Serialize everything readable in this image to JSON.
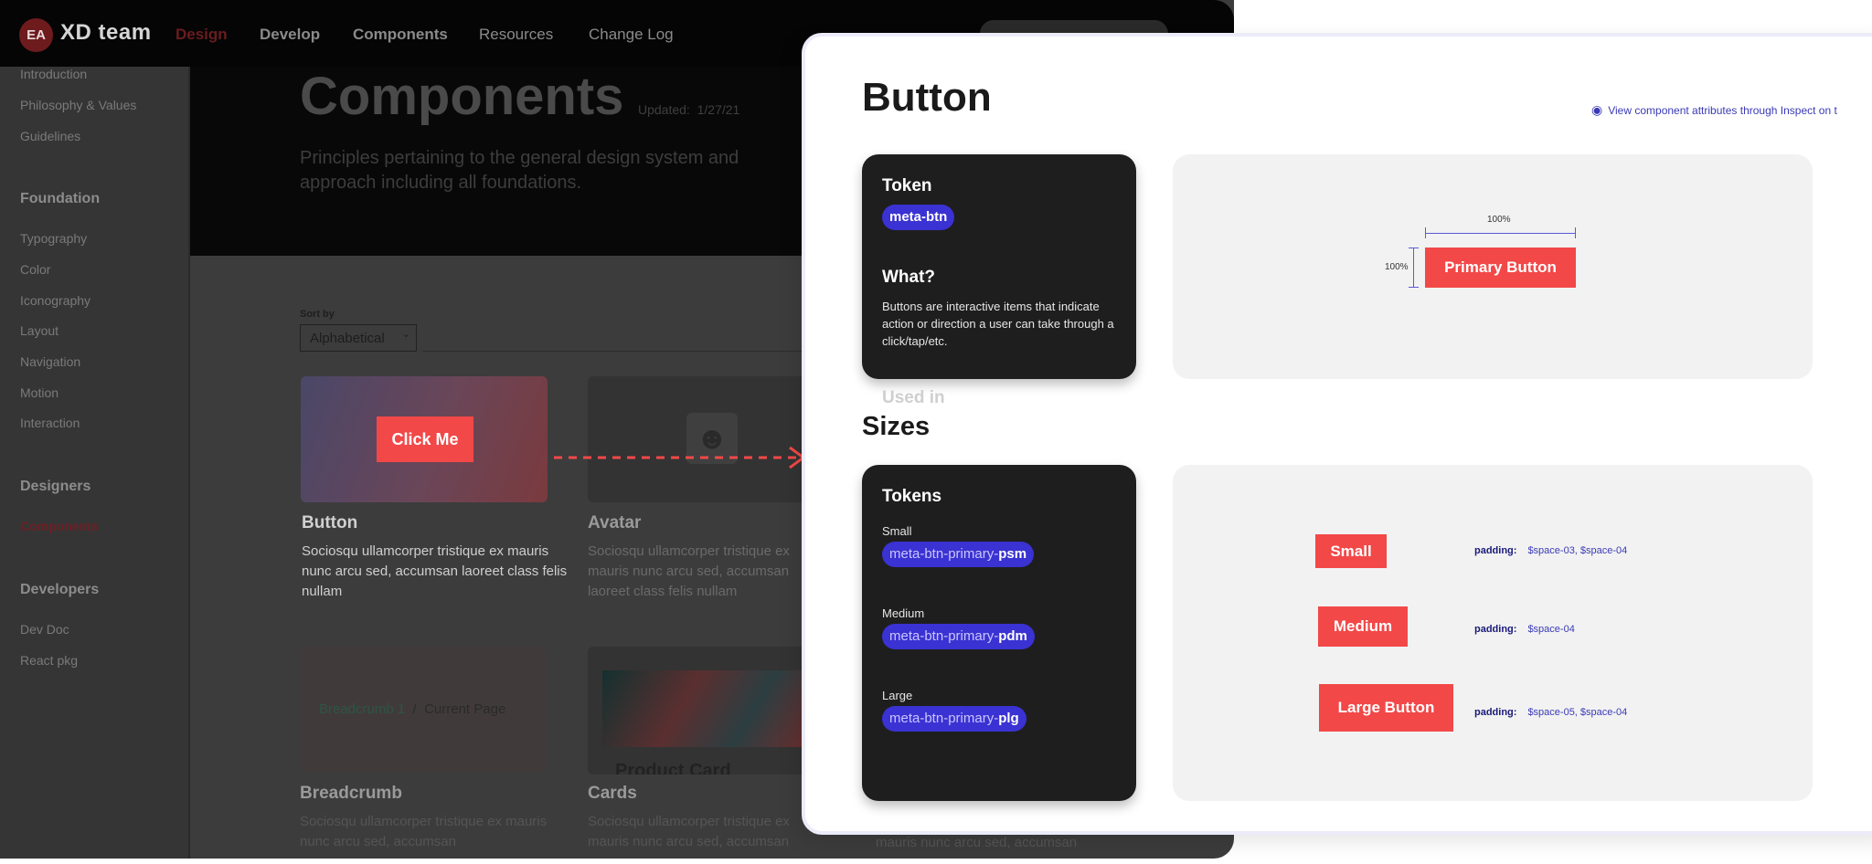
{
  "background": {
    "logo": {
      "badge": "EA",
      "name": "XD team"
    },
    "nav": [
      "Design",
      "Develop",
      "Components",
      "Resources",
      "Change Log"
    ],
    "sidebar": {
      "intro": [
        "Introduction",
        "Philosophy & Values",
        "Guidelines"
      ],
      "foundation_head": "Foundation",
      "foundation": [
        "Typography",
        "Color",
        "Iconography",
        "Layout",
        "Navigation",
        "Motion",
        "Interaction"
      ],
      "designers_head": "Designers",
      "designers": [
        "Components"
      ],
      "developers_head": "Developers",
      "developers": [
        "Dev Doc",
        "React pkg"
      ]
    },
    "hero": {
      "title": "Components",
      "updated_label": "Updated:",
      "updated_value": "1/27/21",
      "description": "Principles pertaining to the general design system and approach including all foundations."
    },
    "sort": {
      "label": "Sort by",
      "value": "Alphabetical"
    },
    "cards": {
      "button": {
        "preview_label": "Click Me",
        "title": "Button",
        "desc": "Sociosqu ullamcorper tristique ex mauris nunc arcu sed, accumsan laoreet class felis nullam"
      },
      "avatar": {
        "title": "Avatar",
        "desc": "Sociosqu ullamcorper tristique ex mauris nunc arcu sed, accumsan laoreet class felis nullam"
      },
      "breadcrumb": {
        "link": "Breadcrumb 1",
        "sep": "/",
        "current": "Current Page",
        "title": "Breadcrumb",
        "desc": "Sociosqu ullamcorper tristique ex mauris nunc arcu sed, accumsan"
      },
      "cards": {
        "preview_label": "Product Card",
        "title": "Cards",
        "desc": "Sociosqu ullamcorper tristique ex mauris nunc arcu sed, accumsan"
      },
      "third_desc": "mauris nunc arcu sed, accumsan"
    }
  },
  "panel": {
    "title": "Button",
    "inspect_link": "View component attributes through Inspect on t",
    "token_card": {
      "token_head": "Token",
      "token": "meta-btn",
      "what_head": "What?",
      "what_text": "Buttons are interactive items that indicate action or direction a user can take through a click/tap/etc.",
      "ghost": "Used in"
    },
    "preview": {
      "button": "Primary Button",
      "width": "100%",
      "height": "100%"
    },
    "sizes_title": "Sizes",
    "sizes_card": {
      "head": "Tokens",
      "items": [
        {
          "label": "Small",
          "prefix": "meta-btn-primary-",
          "suffix": "psm"
        },
        {
          "label": "Medium",
          "prefix": "meta-btn-primary-",
          "suffix": "pdm"
        },
        {
          "label": "Large",
          "prefix": "meta-btn-primary-",
          "suffix": "plg"
        }
      ]
    },
    "sizes_preview": {
      "padding_label": "padding:",
      "rows": [
        {
          "button": "Small",
          "padding": "$space-03,  $space-04"
        },
        {
          "button": "Medium",
          "padding": "$space-04"
        },
        {
          "button": "Large Button",
          "padding": "$space-05,  $space-04"
        }
      ]
    }
  },
  "colors": {
    "accent_red": "#f24848",
    "token_blue": "#3a32d2",
    "dark_card": "#1e1e1e"
  }
}
